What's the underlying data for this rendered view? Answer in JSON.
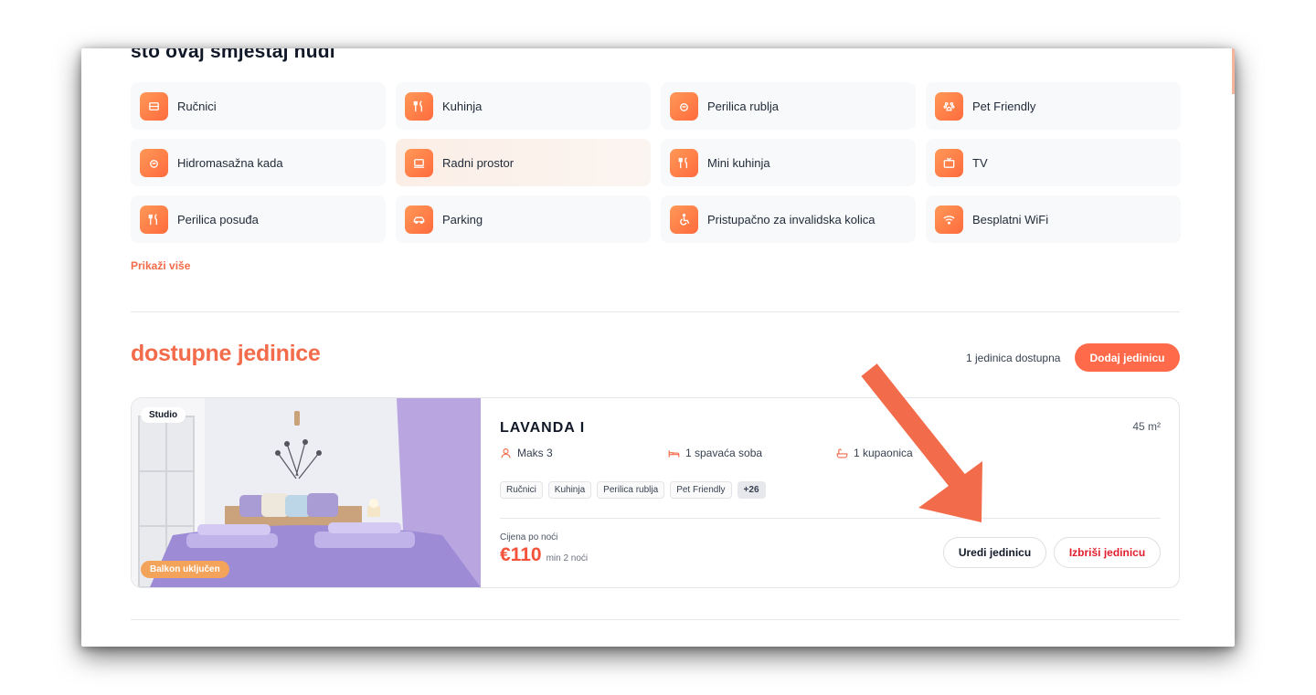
{
  "amenities_section": {
    "title": "što ovaj smještaj nudi",
    "items": [
      {
        "label": "Ručnici",
        "icon": "towel-icon"
      },
      {
        "label": "Kuhinja",
        "icon": "utensils-icon"
      },
      {
        "label": "Perilica rublja",
        "icon": "washing-machine-icon"
      },
      {
        "label": "Pet Friendly",
        "icon": "paw-icon"
      },
      {
        "label": "Hidromasažna kada",
        "icon": "hot-tub-icon"
      },
      {
        "label": "Radni prostor",
        "icon": "laptop-icon"
      },
      {
        "label": "Mini kuhinja",
        "icon": "utensils-icon"
      },
      {
        "label": "TV",
        "icon": "tv-icon"
      },
      {
        "label": "Perilica posuđa",
        "icon": "utensils-icon"
      },
      {
        "label": "Parking",
        "icon": "car-icon"
      },
      {
        "label": "Pristupačno za invalidska kolica",
        "icon": "wheelchair-icon"
      },
      {
        "label": "Besplatni WiFi",
        "icon": "wifi-icon"
      }
    ],
    "show_more": "Prikaži više"
  },
  "units_section": {
    "title": "dostupne jedinice",
    "count_text": "1 jedinica dostupna",
    "add_button": "Dodaj jedinicu"
  },
  "unit": {
    "type_badge": "Studio",
    "feature_badge": "Balkon uključen",
    "name": "LAVANDA I",
    "size": "45 m²",
    "guests": "Maks 3",
    "bedrooms": "1 spavaća soba",
    "bathrooms": "1 kupaonica",
    "tags": [
      "Ručnici",
      "Kuhinja",
      "Perilica rublja",
      "Pet Friendly"
    ],
    "more_tags": "+26",
    "price_label": "Cijena po noći",
    "price": "€110",
    "min_stay": "min 2 noći",
    "edit_button": "Uredi jedinicu",
    "delete_button": "Izbriši jedinicu"
  },
  "colors": {
    "accent": "#f26b4a",
    "button_primary": "#ff6b4a",
    "delete_text": "#e11d2e",
    "annotation_arrow": "#f26b4a"
  }
}
